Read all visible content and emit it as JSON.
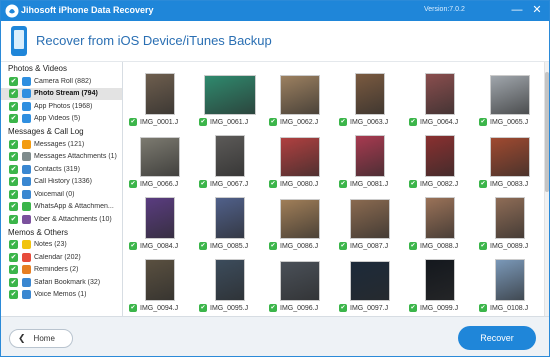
{
  "window": {
    "title": "Jihosoft iPhone Data Recovery",
    "version": "Version:7.0.2",
    "minimize": "—",
    "close": "✕"
  },
  "header": {
    "title": "Recover from iOS Device/iTunes Backup"
  },
  "sidebar": {
    "sections": [
      {
        "title": "Photos & Videos",
        "items": [
          {
            "label": "Camera Roll (882)",
            "icon": "camera-roll-icon",
            "color": "#2f8fe0",
            "active": false
          },
          {
            "label": "Photo Stream (794)",
            "icon": "photo-stream-icon",
            "color": "#2f8fe0",
            "active": true
          },
          {
            "label": "App Photos (1968)",
            "icon": "app-photos-icon",
            "color": "#2f8fe0",
            "active": false
          },
          {
            "label": "App Videos (5)",
            "icon": "app-videos-icon",
            "color": "#2f8fe0",
            "active": false
          }
        ]
      },
      {
        "title": "Messages & Call Log",
        "items": [
          {
            "label": "Messages (121)",
            "icon": "messages-icon",
            "color": "#f39c12",
            "active": false
          },
          {
            "label": "Messages Attachments (1)",
            "icon": "attachments-icon",
            "color": "#7f8c8d",
            "active": false
          },
          {
            "label": "Contacts (319)",
            "icon": "contacts-icon",
            "color": "#3a87d1",
            "active": false
          },
          {
            "label": "Call History (1336)",
            "icon": "call-history-icon",
            "color": "#3a87d1",
            "active": false
          },
          {
            "label": "Voicemail (0)",
            "icon": "voicemail-icon",
            "color": "#3a87d1",
            "active": false
          },
          {
            "label": "WhatsApp & Attachmen...",
            "icon": "whatsapp-icon",
            "color": "#3bb54a",
            "active": false
          },
          {
            "label": "Viber & Attachments (10)",
            "icon": "viber-icon",
            "color": "#7b519d",
            "active": false
          }
        ]
      },
      {
        "title": "Memos & Others",
        "items": [
          {
            "label": "Notes (23)",
            "icon": "notes-icon",
            "color": "#f1c40f",
            "active": false
          },
          {
            "label": "Calendar (202)",
            "icon": "calendar-icon",
            "color": "#e74c3c",
            "active": false
          },
          {
            "label": "Reminders (2)",
            "icon": "reminders-icon",
            "color": "#e67e22",
            "active": false
          },
          {
            "label": "Safari Bookmark (32)",
            "icon": "safari-bookmark-icon",
            "color": "#3a87d1",
            "active": false
          },
          {
            "label": "Voice Memos (1)",
            "icon": "voice-memos-icon",
            "color": "#3a87d1",
            "active": false
          }
        ]
      }
    ]
  },
  "photos": [
    {
      "name": "IMG_0001.J",
      "shape": "tall",
      "color": "#6e5e4e"
    },
    {
      "name": "IMG_0061.J",
      "shape": "wide",
      "color": "#2f8a6e"
    },
    {
      "name": "IMG_0062.J",
      "shape": "square",
      "color": "#9c8060"
    },
    {
      "name": "IMG_0063.J",
      "shape": "tall",
      "color": "#7a5a40"
    },
    {
      "name": "IMG_0064.J",
      "shape": "tall",
      "color": "#8a4e4e"
    },
    {
      "name": "IMG_0065.J",
      "shape": "square",
      "color": "#a0a6ac"
    },
    {
      "name": "IMG_0066.J",
      "shape": "square",
      "color": "#7c7a70"
    },
    {
      "name": "IMG_0067.J",
      "shape": "tall",
      "color": "#5c5a58"
    },
    {
      "name": "IMG_0080.J",
      "shape": "square",
      "color": "#b04040"
    },
    {
      "name": "IMG_0081.J",
      "shape": "tall",
      "color": "#a83a50"
    },
    {
      "name": "IMG_0082.J",
      "shape": "tall",
      "color": "#8a3030"
    },
    {
      "name": "IMG_0083.J",
      "shape": "square",
      "color": "#a04a30"
    },
    {
      "name": "IMG_0084.J",
      "shape": "tall",
      "color": "#5a3c80"
    },
    {
      "name": "IMG_0085.J",
      "shape": "tall",
      "color": "#50608a"
    },
    {
      "name": "IMG_0086.J",
      "shape": "square",
      "color": "#a07e58"
    },
    {
      "name": "IMG_0087.J",
      "shape": "square",
      "color": "#8a6a50"
    },
    {
      "name": "IMG_0088.J",
      "shape": "tall",
      "color": "#9a7258"
    },
    {
      "name": "IMG_0089.J",
      "shape": "tall",
      "color": "#8e6c56"
    },
    {
      "name": "IMG_0094.J",
      "shape": "tall",
      "color": "#5a5040"
    },
    {
      "name": "IMG_0095.J",
      "shape": "tall",
      "color": "#3c4c5c"
    },
    {
      "name": "IMG_0096.J",
      "shape": "square",
      "color": "#4a5058"
    },
    {
      "name": "IMG_0097.J",
      "shape": "square",
      "color": "#1c2a3a"
    },
    {
      "name": "IMG_0099.J",
      "shape": "tall",
      "color": "#14181e"
    },
    {
      "name": "IMG_0108.J",
      "shape": "tall",
      "color": "#7a98b8"
    }
  ],
  "footer": {
    "home_label": "Home",
    "recover_label": "Recover"
  }
}
